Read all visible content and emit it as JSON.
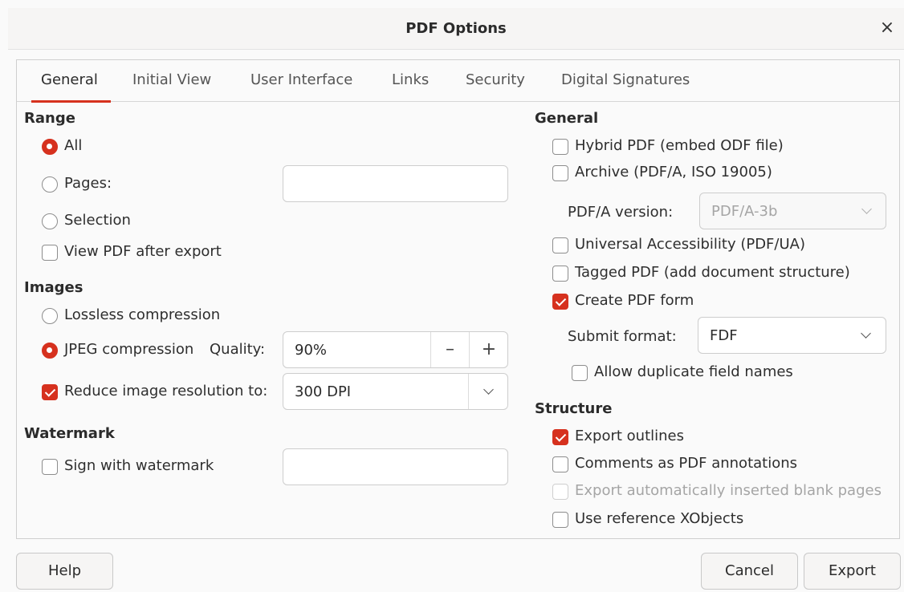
{
  "window": {
    "title": "PDF Options",
    "close_glyph": "×"
  },
  "tabs": [
    {
      "label": "General",
      "active": true
    },
    {
      "label": "Initial View",
      "active": false
    },
    {
      "label": "User Interface",
      "active": false
    },
    {
      "label": "Links",
      "active": false
    },
    {
      "label": "Security",
      "active": false
    },
    {
      "label": "Digital Signatures",
      "active": false
    }
  ],
  "range": {
    "title": "Range",
    "all": "All",
    "pages": "Pages:",
    "pages_value": "",
    "selection": "Selection",
    "selected": "All",
    "view_after_export": "View PDF after export",
    "view_after_export_checked": false
  },
  "images": {
    "title": "Images",
    "lossless": "Lossless compression",
    "jpeg": "JPEG compression",
    "quality_label": "Quality:",
    "quality_value": "90%",
    "minus_glyph": "–",
    "plus_glyph": "+",
    "reduce_resolution": "Reduce image resolution to:",
    "reduce_resolution_checked": true,
    "resolution_value": "300 DPI",
    "selected": "JPEG compression"
  },
  "watermark": {
    "title": "Watermark",
    "sign": "Sign with watermark",
    "sign_checked": false,
    "text_value": ""
  },
  "general": {
    "title": "General",
    "hybrid": "Hybrid PDF (embed ODF file)",
    "archive": "Archive (PDF/A, ISO 19005)",
    "pdfa_version_label": "PDF/A version:",
    "pdfa_version_value": "PDF/A-3b",
    "universal": "Universal Accessibility (PDF/UA)",
    "tagged": "Tagged PDF (add document structure)",
    "create_form": "Create PDF form",
    "create_form_checked": true,
    "submit_format_label": "Submit format:",
    "submit_format_value": "FDF",
    "allow_duplicate": "Allow duplicate field names"
  },
  "structure": {
    "title": "Structure",
    "export_outlines": "Export outlines",
    "export_outlines_checked": true,
    "comments": "Comments as PDF annotations",
    "blank_pages": "Export automatically inserted blank pages",
    "xobjects": "Use reference XObjects"
  },
  "buttons": {
    "help": "Help",
    "cancel": "Cancel",
    "export": "Export"
  },
  "colors": {
    "accent": "#d6311e",
    "disabled_text": "#a5a5a5"
  }
}
